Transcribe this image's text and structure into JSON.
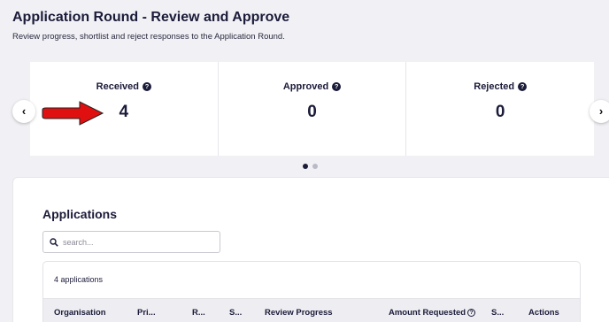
{
  "header": {
    "title": "Application Round - Review and Approve",
    "subtitle": "Review progress, shortlist and reject responses to the Application Round."
  },
  "stats": [
    {
      "label": "Received",
      "value": "4"
    },
    {
      "label": "Approved",
      "value": "0"
    },
    {
      "label": "Rejected",
      "value": "0"
    }
  ],
  "carousel": {
    "prev_icon": "‹",
    "next_icon": "›",
    "active_page": 1,
    "page_count": 2
  },
  "annotation": {
    "arrow_color": "#e01010",
    "points_to": "Received"
  },
  "applications": {
    "title": "Applications",
    "search_placeholder": "search...",
    "count_text": "4 applications",
    "columns": [
      "Organisation",
      "Pri...",
      "R...",
      "S...",
      "Review Progress",
      "Amount Requested",
      "S...",
      "Actions"
    ]
  }
}
